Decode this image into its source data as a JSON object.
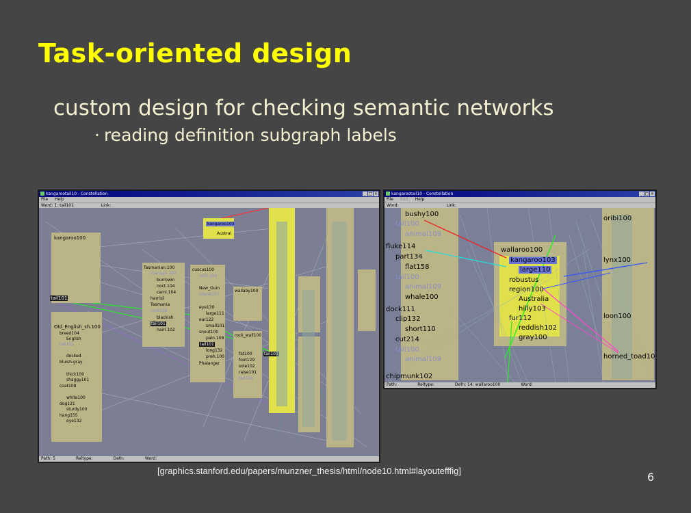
{
  "slide": {
    "title": "Task-oriented design",
    "subtitle": "custom design for checking semantic networks",
    "bullet_marker": "·",
    "bullet": "reading definition subgraph labels",
    "caption": "[graphics.stanford.edu/papers/munzner_thesis/html/node10.html#layoutefffig]",
    "page_number": "6"
  },
  "left_window": {
    "title": "kangarootail10 - Constellation",
    "menu": [
      "File",
      "Help"
    ],
    "field_word": "Word: 1: tail101",
    "field_link": "Link:",
    "status": [
      "Path: 5",
      "Reltype:",
      "Defn:",
      "Word:"
    ],
    "labels": [
      "kangaroo100",
      "tail101",
      "Old_English_sh.100",
      "Tasmanian.100",
      "burrowin",
      "noct.104",
      "carni.104",
      "harrisii",
      "Tasmania",
      "blackish",
      "tail101",
      "hairl.102",
      "cuscus100",
      "New_Guin",
      "eye130",
      "large111",
      "ear122",
      "small101",
      "snout100",
      "pain.108",
      "tail101",
      "long132",
      "preh.100",
      "Phalanger",
      "wallaby100",
      "rock_wall100",
      "kangaroo103",
      "Austral",
      "tail101",
      "breed104",
      "English",
      "docked",
      "bluish-gray",
      "thick100",
      "shaggy101",
      "coat108",
      "white100",
      "dog121",
      "sturdy100",
      "hang155",
      "eye132",
      "fat100",
      "foot129",
      "sole102",
      "raise101"
    ],
    "ghost_labels": [
      "tail101",
      "marsupi.100",
      "island107",
      "coat108",
      "coat109",
      "noct.104",
      "edge108",
      "tail101"
    ],
    "highlight_labels": [
      "tail101",
      "tail101",
      "tail101",
      "tail101"
    ]
  },
  "right_window": {
    "title": "kangarootail10 - Constellation",
    "menu": [
      "File",
      "Edit",
      "Help"
    ],
    "field_word": "Word:",
    "field_link": "Link:",
    "status": [
      "Path:",
      "Reltype:",
      "Defn: 14: wallaroo100",
      "Word:"
    ],
    "labels": [
      "bushy100",
      "fluke114",
      "part134",
      "flat158",
      "whale100",
      "dock111",
      "clip132",
      "short110",
      "cut214",
      "chipmunk102",
      "wallaroo100",
      "robustus",
      "region100",
      "Australia",
      "hilly103",
      "fur112",
      "reddish102",
      "gray100",
      "oribi100",
      "lynx100",
      "loon100",
      "horned_toad100"
    ],
    "ghost_labels": [
      "tail100",
      "animal109",
      "tail100",
      "animal109",
      "tail100",
      "animal109"
    ],
    "selected_labels": [
      "kangaroo103",
      "large110"
    ]
  },
  "colors": {
    "background": "#454545",
    "title": "#ffff00",
    "text": "#f4f1d2",
    "node_box": "#bbb486",
    "highlight_box": "#e0e04a",
    "canvas": "#7c7f93"
  }
}
